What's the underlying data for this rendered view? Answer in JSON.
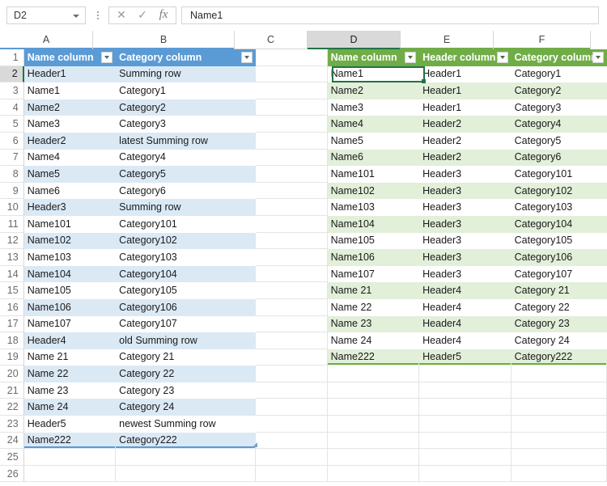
{
  "formula_bar": {
    "name_box_value": "D2",
    "name_box_caret_icon": "chevron-down-icon",
    "kebab_icon": "more-options-icon",
    "cancel_icon": "✕",
    "confirm_icon": "✓",
    "function_icon": "fx",
    "formula_value": "Name1"
  },
  "grid": {
    "columns": [
      "A",
      "B",
      "C",
      "D",
      "E",
      "F"
    ],
    "selected_column": "D",
    "selected_row": 2,
    "selected_cell": "D2",
    "row_numbers": [
      1,
      2,
      3,
      4,
      5,
      6,
      7,
      8,
      9,
      10,
      11,
      12,
      13,
      14,
      15,
      16,
      17,
      18,
      19,
      20,
      21,
      22,
      23,
      24,
      25,
      26
    ]
  },
  "table_left": {
    "theme_color": "#5b9bd5",
    "band_color": "#dbe9f5",
    "header_row": 1,
    "headers": [
      "Name column",
      "Category column"
    ],
    "filter_icon": "filter-dropdown-icon",
    "rows": [
      [
        "Header1",
        "Summing row"
      ],
      [
        "Name1",
        "Category1"
      ],
      [
        "Name2",
        "Category2"
      ],
      [
        "Name3",
        "Category3"
      ],
      [
        "Header2",
        "latest Summing row"
      ],
      [
        "Name4",
        "Category4"
      ],
      [
        "Name5",
        "Category5"
      ],
      [
        "Name6",
        "Category6"
      ],
      [
        "Header3",
        "Summing row"
      ],
      [
        "Name101",
        "Category101"
      ],
      [
        "Name102",
        "Category102"
      ],
      [
        "Name103",
        "Category103"
      ],
      [
        "Name104",
        "Category104"
      ],
      [
        "Name105",
        "Category105"
      ],
      [
        "Name106",
        "Category106"
      ],
      [
        "Name107",
        "Category107"
      ],
      [
        "Header4",
        "old Summing row"
      ],
      [
        "Name 21",
        "Category 21"
      ],
      [
        "Name 22",
        "Category 22"
      ],
      [
        "Name 23",
        "Category 23"
      ],
      [
        "Name 24",
        "Category 24"
      ],
      [
        "Header5",
        "newest Summing row"
      ],
      [
        "Name222",
        "Category222"
      ]
    ]
  },
  "table_right": {
    "theme_color": "#70ad47",
    "band_color": "#e2efd9",
    "header_row": 1,
    "headers": [
      "Name column",
      "Header column",
      "Category column"
    ],
    "filter_icon": "filter-dropdown-icon",
    "rows": [
      [
        "Name1",
        "Header1",
        "Category1"
      ],
      [
        "Name2",
        "Header1",
        "Category2"
      ],
      [
        "Name3",
        "Header1",
        "Category3"
      ],
      [
        "Name4",
        "Header2",
        "Category4"
      ],
      [
        "Name5",
        "Header2",
        "Category5"
      ],
      [
        "Name6",
        "Header2",
        "Category6"
      ],
      [
        "Name101",
        "Header3",
        "Category101"
      ],
      [
        "Name102",
        "Header3",
        "Category102"
      ],
      [
        "Name103",
        "Header3",
        "Category103"
      ],
      [
        "Name104",
        "Header3",
        "Category104"
      ],
      [
        "Name105",
        "Header3",
        "Category105"
      ],
      [
        "Name106",
        "Header3",
        "Category106"
      ],
      [
        "Name107",
        "Header3",
        "Category107"
      ],
      [
        "Name 21",
        "Header4",
        "Category 21"
      ],
      [
        "Name 22",
        "Header4",
        "Category 22"
      ],
      [
        "Name 23",
        "Header4",
        "Category 23"
      ],
      [
        "Name 24",
        "Header4",
        "Category 24"
      ],
      [
        "Name222",
        "Header5",
        "Category222"
      ]
    ]
  }
}
